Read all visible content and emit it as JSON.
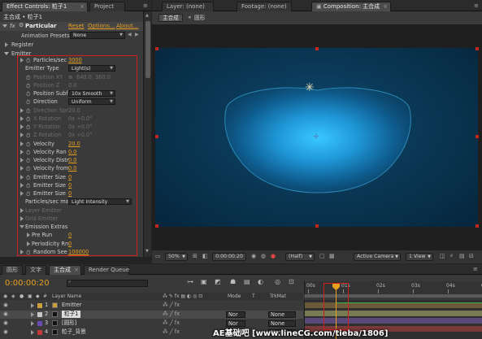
{
  "left_tabs": {
    "effect_controls": "Effect Controls: 粒子1",
    "project": "Project"
  },
  "right_tabs": {
    "layer": "Layer: (none)",
    "footage": "Footage: (none)",
    "composition": "Composition: 主合成"
  },
  "effect": {
    "breadcrumb": "主合成 • 粒子1",
    "fx_label": "fx",
    "name": "Particular",
    "reset": "Reset",
    "options": "Options...",
    "about": "About...",
    "animation_presets_label": "Animation Presets:",
    "animation_presets_value": "None",
    "register": "Register",
    "emitter_group": "Emitter",
    "properties": [
      {
        "label": "Particles/sec",
        "value": "3000",
        "kind": "number",
        "stopwatch": true,
        "twirl": true
      },
      {
        "label": "Emitter Type",
        "value": "Light(s)",
        "kind": "dropdown"
      },
      {
        "label": "Position XY",
        "value": "640.0, 360.0",
        "kind": "dim",
        "stopwatch": true,
        "crosshair": true
      },
      {
        "label": "Position Z",
        "value": "0.0",
        "kind": "dim",
        "stopwatch": true
      },
      {
        "label": "Position Subf",
        "value": "10x Smooth",
        "kind": "dropdown",
        "stopwatch": true
      },
      {
        "label": "Direction",
        "value": "Uniform",
        "kind": "dropdown",
        "stopwatch": true
      },
      {
        "label": "Direction Spr",
        "value": "20.0",
        "kind": "dim",
        "stopwatch": true,
        "twirl": true
      },
      {
        "label": "X Rotation",
        "value": "0x +0.0°",
        "kind": "dim",
        "stopwatch": true,
        "twirl": true
      },
      {
        "label": "Y Rotation",
        "value": "0x +0.0°",
        "kind": "dim",
        "stopwatch": true,
        "twirl": true
      },
      {
        "label": "Z Rotation",
        "value": "0x +0.0°",
        "kind": "dim",
        "stopwatch": true,
        "twirl": true
      },
      {
        "label": "Velocity",
        "value": "20.0",
        "kind": "number",
        "stopwatch": true,
        "twirl": true
      },
      {
        "label": "Velocity Ran",
        "value": "0.0",
        "kind": "number",
        "stopwatch": true,
        "twirl": true
      },
      {
        "label": "Velocity Distr",
        "value": "0.0",
        "kind": "number",
        "stopwatch": true,
        "twirl": true
      },
      {
        "label": "Velocity from",
        "value": "0.0",
        "kind": "number",
        "stopwatch": true,
        "twirl": true
      },
      {
        "label": "Emitter Size",
        "value": "0",
        "kind": "number",
        "stopwatch": true,
        "twirl": true
      },
      {
        "label": "Emitter Size",
        "value": "0",
        "kind": "number",
        "stopwatch": true,
        "twirl": true
      },
      {
        "label": "Emitter Size",
        "value": "0",
        "kind": "number",
        "stopwatch": true,
        "twirl": true
      },
      {
        "label": "Particles/sec mo",
        "value": "Light Intensity",
        "kind": "dropdown"
      },
      {
        "label": "Layer Emitter",
        "value": "",
        "kind": "dimgroup",
        "twirl": true
      },
      {
        "label": "Grid Emitter",
        "value": "",
        "kind": "dimgroup",
        "twirl": true
      },
      {
        "label": "Emission Extras",
        "value": "",
        "kind": "group",
        "twirl": true,
        "open": true
      },
      {
        "label": "Pre Run",
        "value": "0",
        "kind": "number",
        "twirl": true,
        "indent": 2
      },
      {
        "label": "Periodicity Rn",
        "value": "0",
        "kind": "number",
        "twirl": true,
        "indent": 2
      },
      {
        "label": "Random See",
        "value": "100000",
        "kind": "number",
        "stopwatch": true,
        "twirl": true
      }
    ]
  },
  "comp": {
    "subtab_main": "主合成",
    "subtab_shape": "圆形",
    "footer": {
      "zoom": "50%",
      "timecode": "0:00:00:20",
      "resolution": "(Half)",
      "camera": "Active Camera",
      "view": "1 View"
    }
  },
  "bottom_tabs": {
    "circle": "圆形",
    "text": "文字",
    "main": "主合成",
    "render": "Render Queue"
  },
  "timeline": {
    "timecode": "0:00:00:20",
    "search_placeholder": "",
    "col_layer_name": "Layer Name",
    "col_mode": "Mode",
    "col_t": "T",
    "col_trkmat": "TrkMat",
    "layers": [
      {
        "num": "1",
        "name": "Emitter",
        "color": "#c8a13a",
        "mode": "",
        "trk": ""
      },
      {
        "num": "2",
        "name": "粒子1",
        "color": "#c8c8c8",
        "mode": "Nor",
        "trk": "None"
      },
      {
        "num": "3",
        "name": "[圆形]",
        "color": "#6a4bb5",
        "mode": "Nor",
        "trk": "None"
      },
      {
        "num": "4",
        "name": "粒子_背景",
        "color": "#c23a3a",
        "mode": "Nor",
        "trk": "None"
      }
    ],
    "ruler": [
      "00s",
      "01s",
      "02s",
      "03s",
      "04s",
      "05s"
    ]
  },
  "watermark": "AE基础吧  [www.lineCG.com/tieba/1806]",
  "colors": {
    "accent": "#e8a020",
    "highlight": "#d0201c",
    "comp_bg": "#0b3a5a"
  }
}
